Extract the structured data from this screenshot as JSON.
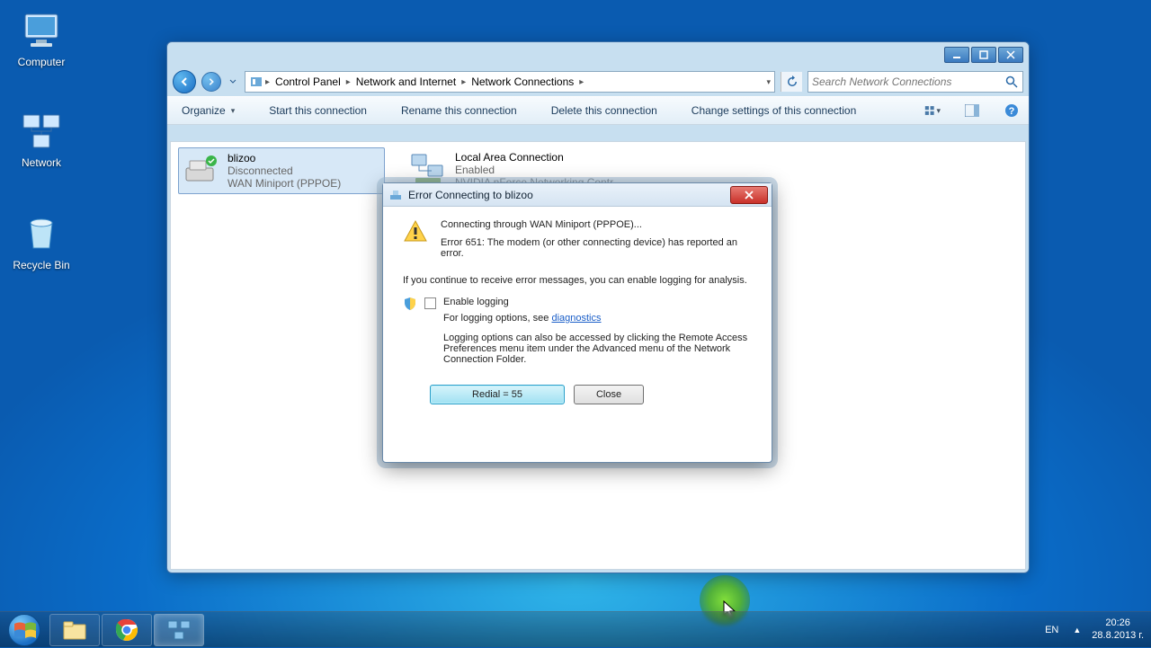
{
  "desktop": {
    "computer": "Computer",
    "network": "Network",
    "recycle": "Recycle Bin"
  },
  "window": {
    "breadcrumbs": [
      "Control Panel",
      "Network and Internet",
      "Network Connections"
    ],
    "search_placeholder": "Search Network Connections",
    "toolbar": {
      "organize": "Organize",
      "start": "Start this connection",
      "rename": "Rename this connection",
      "delete": "Delete this connection",
      "change": "Change settings of this connection"
    },
    "connections": [
      {
        "name": "blizoo",
        "status": "Disconnected",
        "device": "WAN Miniport (PPPOE)"
      },
      {
        "name": "Local Area Connection",
        "status": "Enabled",
        "device": "NVIDIA nForce Networking Contr..."
      }
    ]
  },
  "dialog": {
    "title": "Error Connecting to blizoo",
    "connecting": "Connecting through WAN Miniport (PPPOE)...",
    "error": "Error 651: The modem (or other connecting device) has reported an error.",
    "hint": "If you continue to receive error messages, you can enable logging for analysis.",
    "enable_logging": "Enable logging",
    "logging_options_pre": "For logging options, see ",
    "diagnostics": "diagnostics",
    "logging_note": "Logging options can also be accessed by clicking the Remote Access Preferences menu item under the Advanced menu of the Network Connection Folder.",
    "redial": "Redial = 55",
    "close": "Close"
  },
  "tray": {
    "lang": "EN",
    "time": "20:26",
    "date": "28.8.2013 г."
  }
}
